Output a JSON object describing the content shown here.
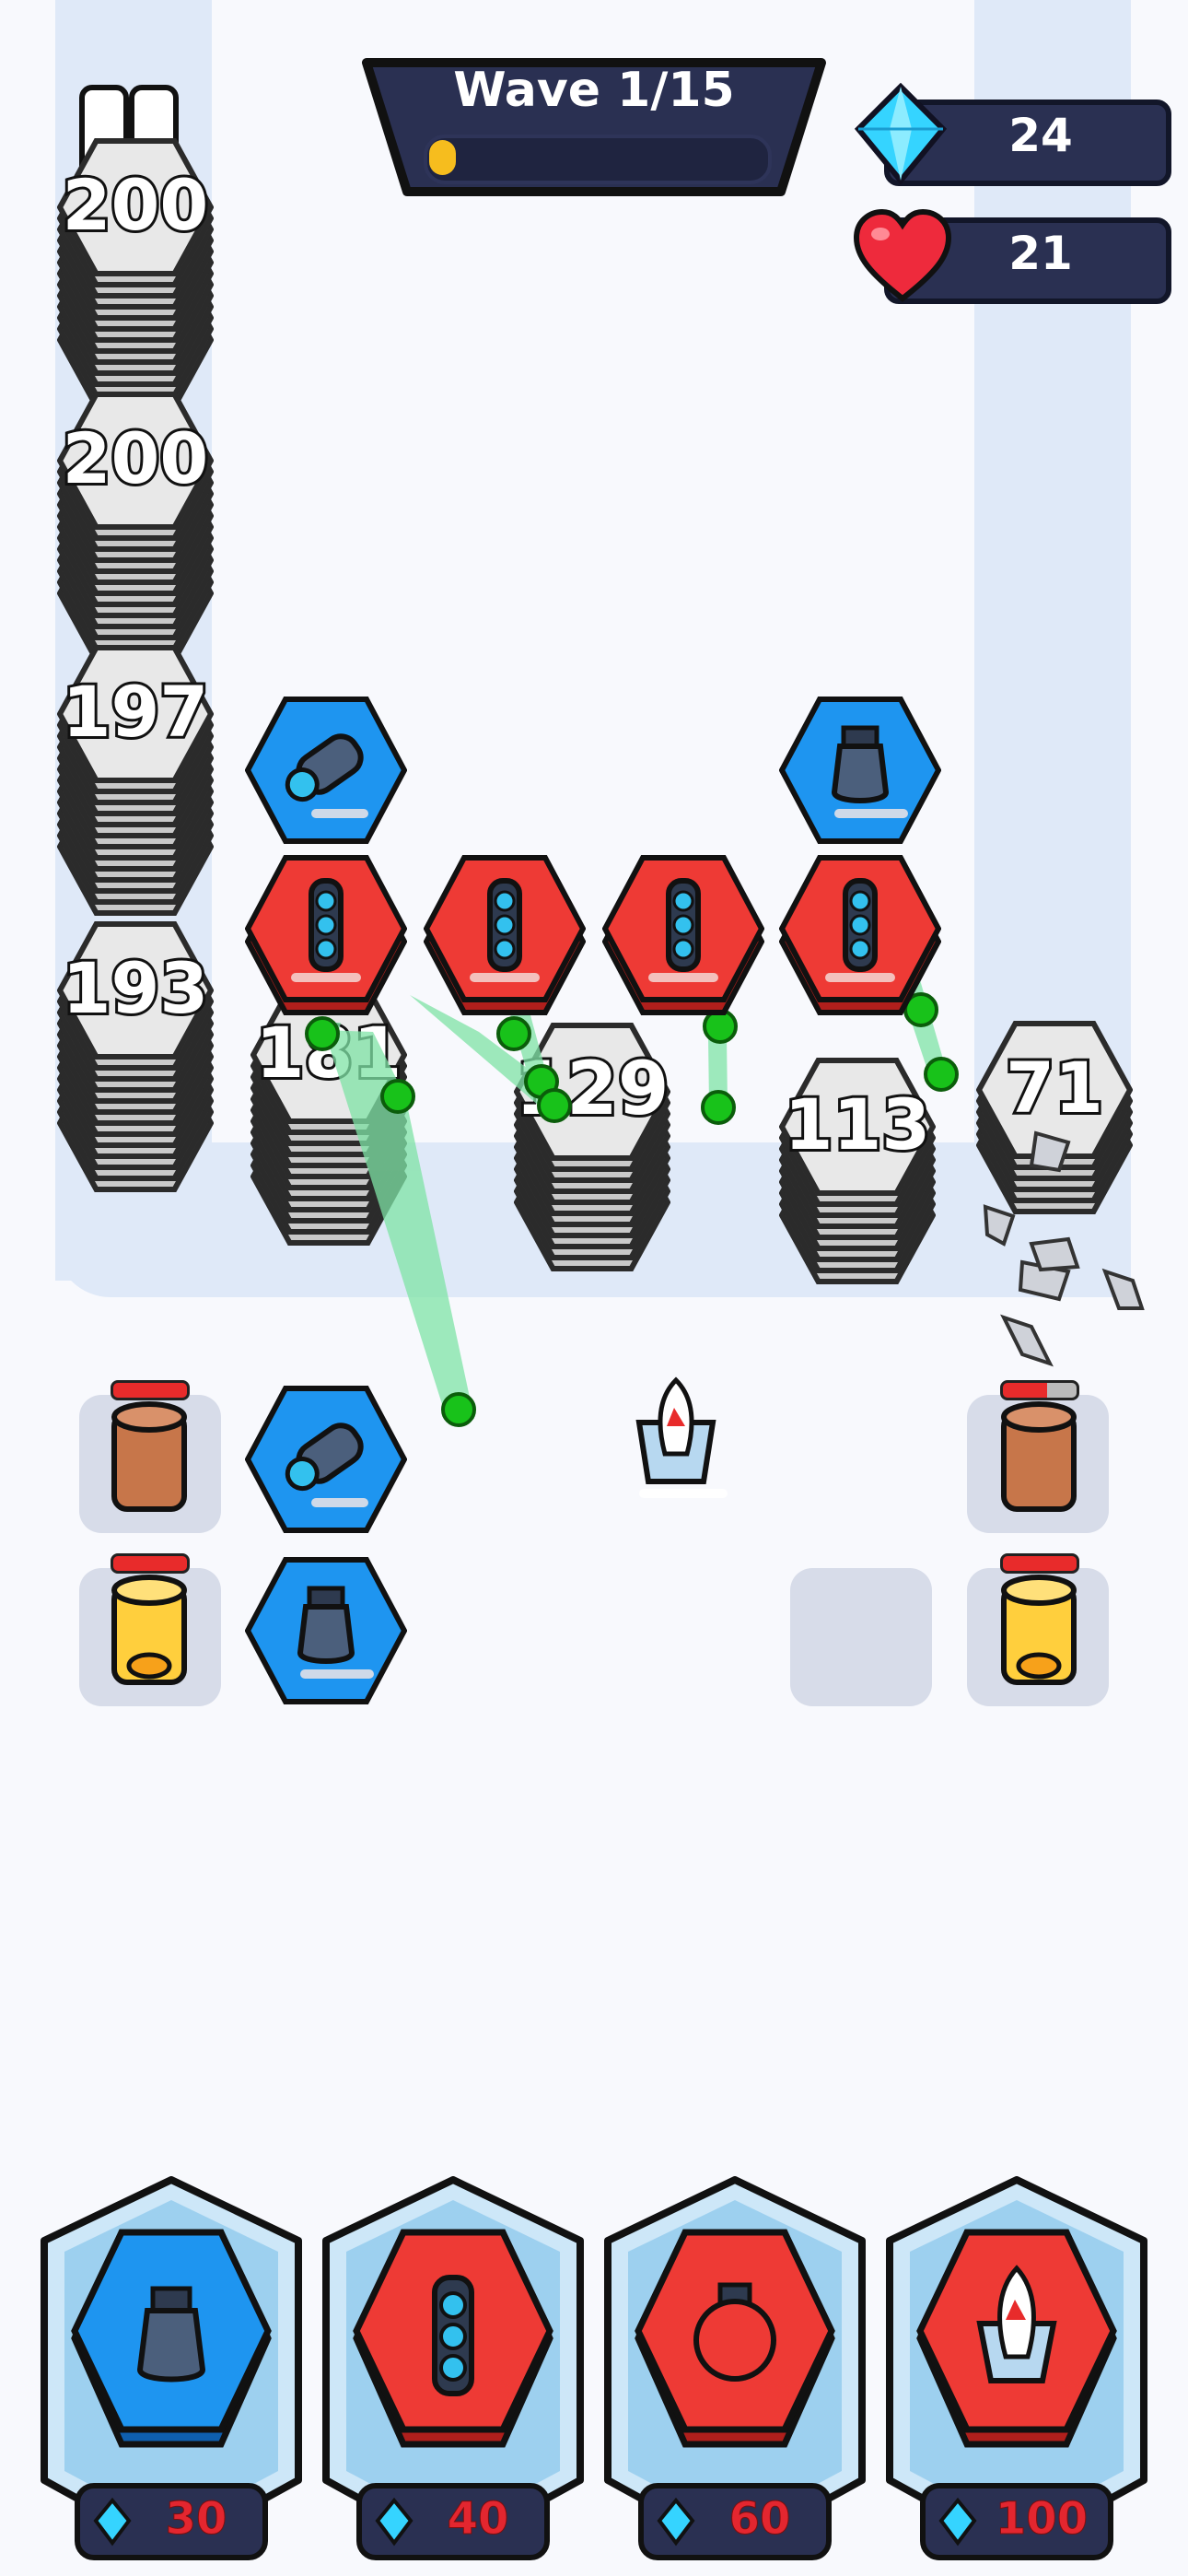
{
  "hud": {
    "wave_label": "Wave  1/15",
    "wave_progress": 0.08,
    "gems": "24",
    "lives": "21",
    "gem_icon": "gem-icon",
    "heart_icon": "heart-icon",
    "pause_icon": "pause-icon"
  },
  "enemy_stacks": [
    {
      "label": "200"
    },
    {
      "label": "200"
    },
    {
      "label": "197"
    },
    {
      "label": "193"
    },
    {
      "label": "181"
    },
    {
      "label": "129"
    },
    {
      "label": "113"
    },
    {
      "label": "71"
    }
  ],
  "towers": [
    {
      "type": "cannon",
      "color": "blue"
    },
    {
      "type": "bomb",
      "color": "blue"
    },
    {
      "type": "gatling",
      "color": "red"
    },
    {
      "type": "gatling",
      "color": "red"
    },
    {
      "type": "gatling",
      "color": "red"
    },
    {
      "type": "gatling",
      "color": "red"
    },
    {
      "type": "cannon",
      "color": "blue"
    },
    {
      "type": "bomb",
      "color": "blue"
    },
    {
      "type": "rocket",
      "color": "red"
    }
  ],
  "shop": [
    {
      "name": "bomb-tower",
      "icon": "bomb-icon",
      "color": "blue",
      "cost": "30"
    },
    {
      "name": "gatling-tower",
      "icon": "gatling-icon",
      "color": "red",
      "cost": "40"
    },
    {
      "name": "orb-tower",
      "icon": "orb-icon",
      "color": "red",
      "cost": "60"
    },
    {
      "name": "rocket-tower",
      "icon": "rocket-icon",
      "color": "red",
      "cost": "100"
    }
  ],
  "colors": {
    "blue": "#1e95f0",
    "red": "#ee3a35",
    "gray": "#e8e8e8",
    "navy": "#2a3052",
    "gold": "#f6bd1e"
  }
}
